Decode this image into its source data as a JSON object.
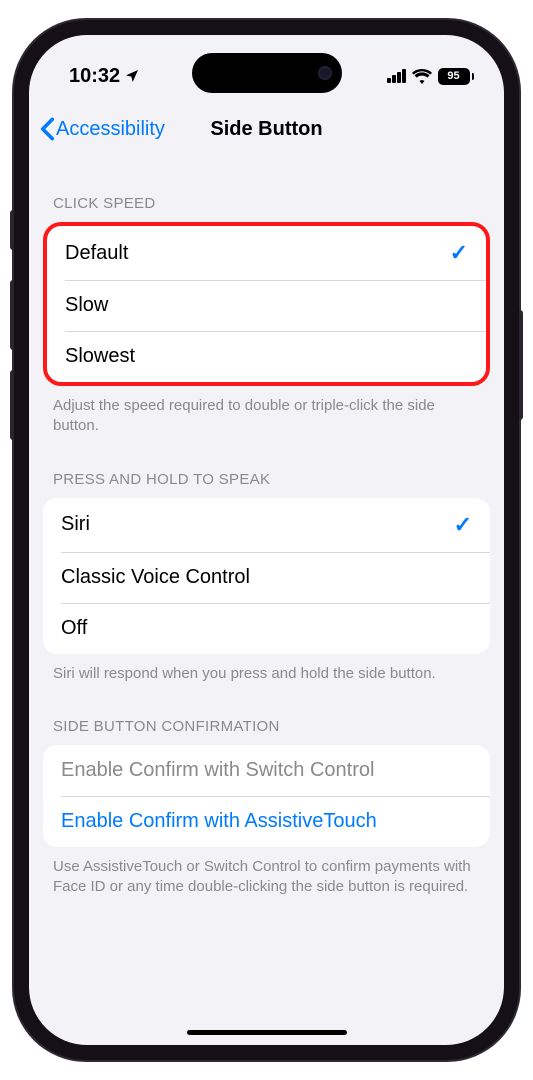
{
  "status": {
    "time": "10:32",
    "battery": "95"
  },
  "nav": {
    "back": "Accessibility",
    "title": "Side Button"
  },
  "sections": {
    "click_speed": {
      "header": "CLICK SPEED",
      "items": [
        "Default",
        "Slow",
        "Slowest"
      ],
      "selected": 0,
      "footer": "Adjust the speed required to double or triple-click the side button."
    },
    "press_hold": {
      "header": "PRESS AND HOLD TO SPEAK",
      "items": [
        "Siri",
        "Classic Voice Control",
        "Off"
      ],
      "selected": 0,
      "footer": "Siri will respond when you press and hold the side button."
    },
    "confirmation": {
      "header": "SIDE BUTTON CONFIRMATION",
      "item_disabled": "Enable Confirm with Switch Control",
      "item_link": "Enable Confirm with AssistiveTouch",
      "footer": "Use AssistiveTouch or Switch Control to confirm payments with Face ID or any time double-clicking the side button is required."
    }
  }
}
